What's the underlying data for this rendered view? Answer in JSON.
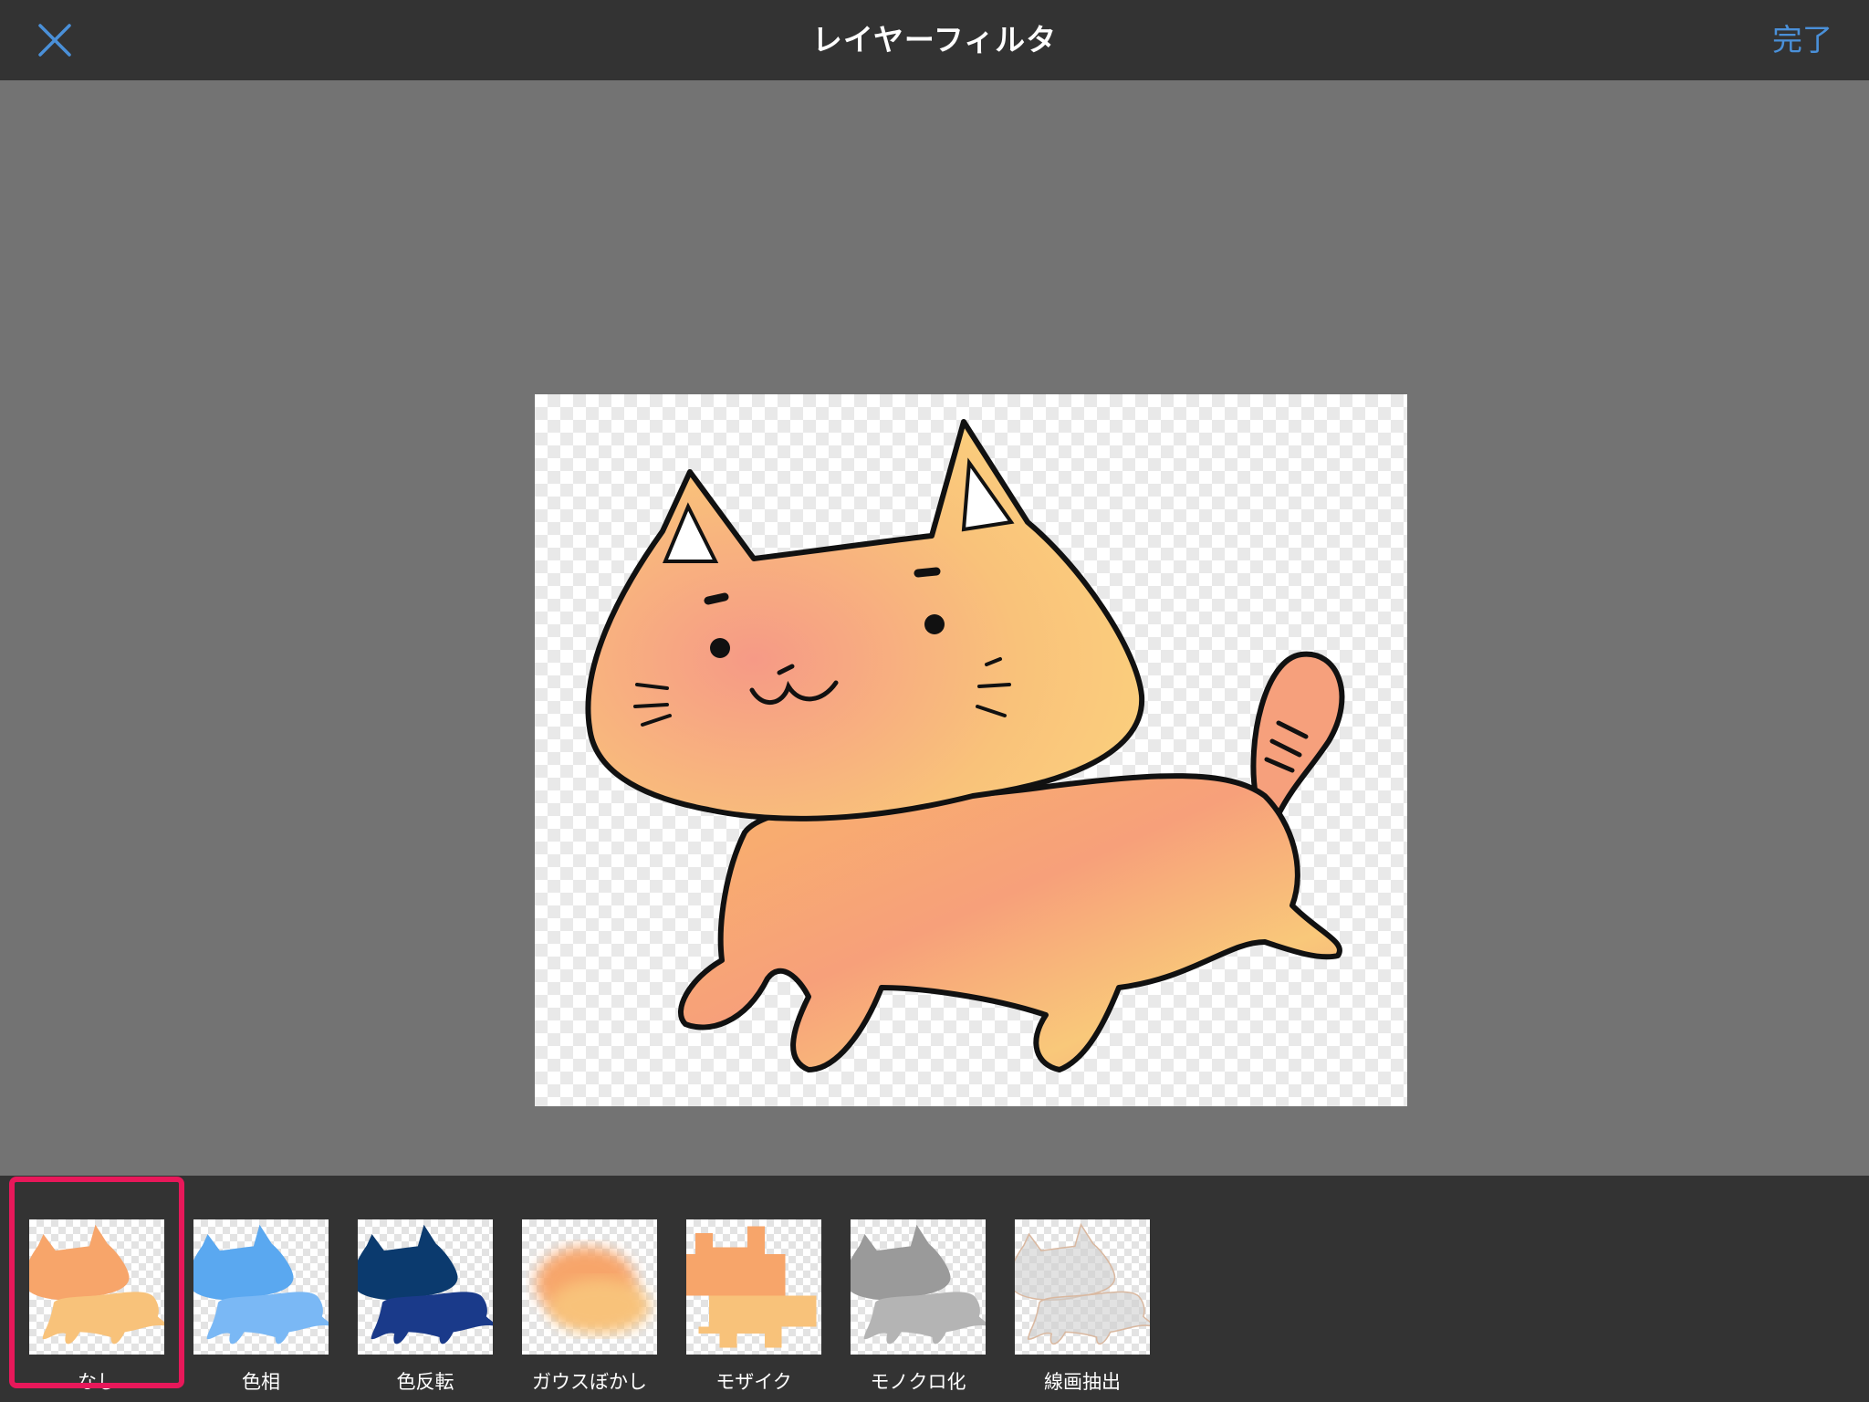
{
  "header": {
    "title": "レイヤーフィルタ",
    "done_label": "完了"
  },
  "colors": {
    "accent": "#4a90d9",
    "selection": "#e8185a",
    "bar": "#333333",
    "canvas_bg": "#737373"
  },
  "filters": [
    {
      "label": "なし",
      "selected": true
    },
    {
      "label": "色相",
      "selected": false
    },
    {
      "label": "色反転",
      "selected": false
    },
    {
      "label": "ガウスぼかし",
      "selected": false
    },
    {
      "label": "モザイク",
      "selected": false
    },
    {
      "label": "モノクロ化",
      "selected": false
    },
    {
      "label": "線画抽出",
      "selected": false
    }
  ]
}
